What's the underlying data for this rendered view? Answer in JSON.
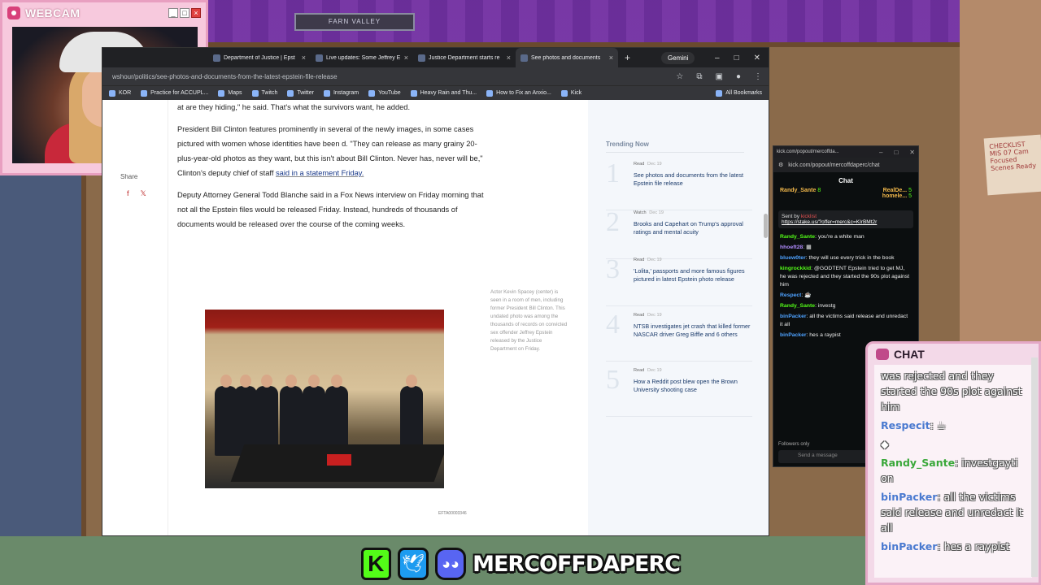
{
  "webcam": {
    "title": "WEBCAM"
  },
  "background": {
    "sign": "FARN VALLEY",
    "note": "CHECKLIST MIS 07 Cam Focused Scenes Ready"
  },
  "browser": {
    "tabs": [
      {
        "label": "Department of Justice | Epst",
        "active": false
      },
      {
        "label": "Live updates: Some Jeffrey E",
        "active": false
      },
      {
        "label": "Justice Department starts re",
        "active": false
      },
      {
        "label": "See photos and documents",
        "active": true
      }
    ],
    "gemini_label": "Gemini",
    "url": "wshour/politics/see-photos-and-documents-from-the-latest-epstein-file-release",
    "bookmarks": [
      "KOR",
      "Practice for ACCUPL...",
      "Maps",
      "Twitch",
      "Twitter",
      "Instagram",
      "YouTube",
      "Heavy Rain and Thu...",
      "How to Fix an Anxio...",
      "Kick"
    ],
    "all_bookmarks": "All Bookmarks"
  },
  "article": {
    "share_label": "Share",
    "p1": "at are they hiding,\" he said. That's what the survivors want, he added.",
    "p2": "President Bill Clinton features prominently in several of the newly images, in some cases pictured with women whose identities have been d. \"They can release as many grainy 20-plus-year-old photos as they want, but this isn't about Bill Clinton. Never has, never will be,\" Clinton's deputy chief of staff",
    "p2_link": "said in a statement Friday.",
    "p3": "Deputy Attorney General Todd Blanche said in a Fox News interview on Friday morning that not all the Epstein files would be released Friday. Instead, hundreds of thousands of documents would be released over the course of the coming weeks.",
    "caption": "Actor Kevin Spacey (center) is seen in a room of men, including former President Bill Clinton. This undated photo was among the thousands of records on convicted sex offender Jeffrey Epstein released by the Justice Department on Friday.",
    "efta": "EFTA00003346"
  },
  "trending": {
    "title": "Trending Now",
    "items": [
      {
        "num": "1",
        "type": "Read",
        "date": "Dec 19",
        "text": "See photos and documents from the latest Epstein file release"
      },
      {
        "num": "2",
        "type": "Watch",
        "date": "Dec 19",
        "text": "Brooks and Capehart on Trump's approval ratings and mental acuity"
      },
      {
        "num": "3",
        "type": "Read",
        "date": "Dec 19",
        "text": "'Lolita,' passports and more famous figures pictured in latest Epstein photo release"
      },
      {
        "num": "4",
        "type": "Read",
        "date": "Dec 19",
        "text": "NTSB investigates jet crash that killed former NASCAR driver Greg Biffle and 6 others"
      },
      {
        "num": "5",
        "type": "Read",
        "date": "Dec 19",
        "text": "How a Reddit post blew open the Brown University shooting case"
      }
    ]
  },
  "kick": {
    "window_title": "kick.com/popout/mercoffda...",
    "url": "kick.com/popout/mercoffdaperc/chat",
    "header": "Chat",
    "leader1_name": "Randy_Sante",
    "leader1_count": "8",
    "leader2_name": "RealDe...",
    "leader2_count": "5",
    "leader3_name": "homele...",
    "leader3_count": "5",
    "pin_sent_by": "Sent by",
    "pin_user": "kicklist",
    "pin_link": "https://stake.us/?offer=merc&c=KIrBMt2r",
    "messages": [
      {
        "user": "Randy_Sante",
        "color": "green",
        "text": "you're a white man"
      },
      {
        "user": "hhoeft28",
        "color": "purple",
        "text": ""
      },
      {
        "user": "bluew0ter",
        "color": "blue",
        "text": "they will use every trick in the book"
      },
      {
        "user": "kingrockkid",
        "color": "green",
        "text": "@GODTENT Epstein tried to get MJ, he was rejected and they started the 90s plot against him"
      },
      {
        "user": "Respect",
        "color": "blue",
        "text": ""
      },
      {
        "user": "Randy_Sante",
        "color": "green",
        "text": "investg"
      },
      {
        "user": "binPacker",
        "color": "blue",
        "text": "all the victims said release and unredact it all"
      },
      {
        "user": "binPacker",
        "color": "blue",
        "text": "hes a raypist"
      }
    ],
    "followers_label": "Followers only",
    "input_placeholder": "Send a message"
  },
  "overlay_chat": {
    "title": "CHAT",
    "lines": [
      {
        "user": "",
        "text": "was rejected and they started the 90s plot against him"
      },
      {
        "user": "Respecit",
        "text": ""
      },
      {
        "user": "Randy_Sante",
        "text": "investgayti on"
      },
      {
        "user": "binPacker",
        "text": "all the victims said release and unredact it all"
      },
      {
        "user": "binPacker",
        "text": "hes a raypist"
      }
    ]
  },
  "banner": {
    "name": "MERCOFFDAPERC"
  }
}
